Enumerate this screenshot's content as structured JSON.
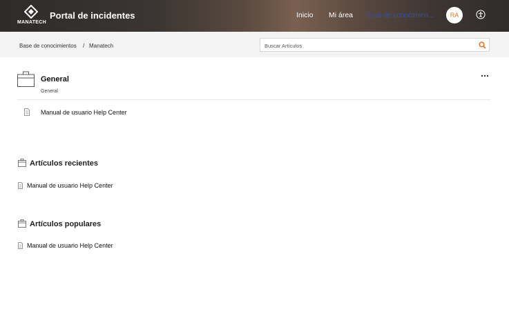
{
  "header": {
    "logo_text": "MANATECH",
    "title": "Portal de incidentes",
    "nav": {
      "inicio": "Inicio",
      "mi_area": "Mi área",
      "base": "Base de conocimien..."
    },
    "avatar_initials": "RA"
  },
  "breadcrumb": {
    "item1": "Base de conocimientos",
    "separator": "/",
    "item2": "Manatech"
  },
  "search": {
    "placeholder": "Buscar Artículos"
  },
  "category": {
    "title": "General",
    "subtitle": "General",
    "articles": [
      "Manual de usuario Help Center"
    ]
  },
  "recent": {
    "title": "Artículos recientes",
    "articles": [
      "Manual de usuario Help Center"
    ]
  },
  "popular": {
    "title": "Artículos populares",
    "articles": [
      "Manual de usuario Help Center"
    ]
  },
  "colors": {
    "accent": "#e2782b",
    "link": "#3a4fa0"
  }
}
